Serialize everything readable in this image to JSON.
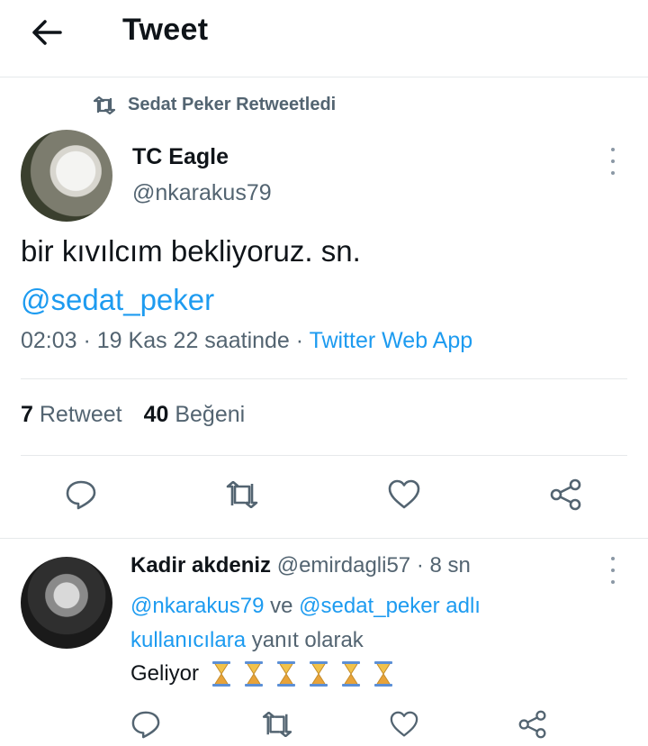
{
  "header": {
    "title": "Tweet"
  },
  "retweet_context": {
    "label": "Sedat Peker Retweetledi"
  },
  "tweet": {
    "name": "TC Eagle",
    "handle": "@nkarakus79",
    "text": "bir kıvılcım bekliyoruz. sn.",
    "mention": "@sedat_peker",
    "time_date": "02:03 · 19 Kas 22 saatinde · ",
    "source": "Twitter Web App",
    "stats": {
      "retweet_count": "7",
      "retweet_label": "Retweet",
      "like_count": "40",
      "like_label": "Beğeni"
    }
  },
  "reply": {
    "name": "Kadir akdeniz",
    "handle": "@emirdagli57",
    "time": " · 8 sn",
    "mention1": "@nkarakus79",
    "and": " ve ",
    "mention2": "@sedat_peker adlı",
    "kullanicilara": "kullanıcılara",
    "suffix": " yanıt olarak",
    "text": "Geliyor",
    "emoji_icon": "hourglass-icon",
    "emoji_count": 6
  },
  "colors": {
    "accent": "#1d9bf0",
    "secondary_text": "#536471",
    "divider": "#e6e9eb"
  }
}
